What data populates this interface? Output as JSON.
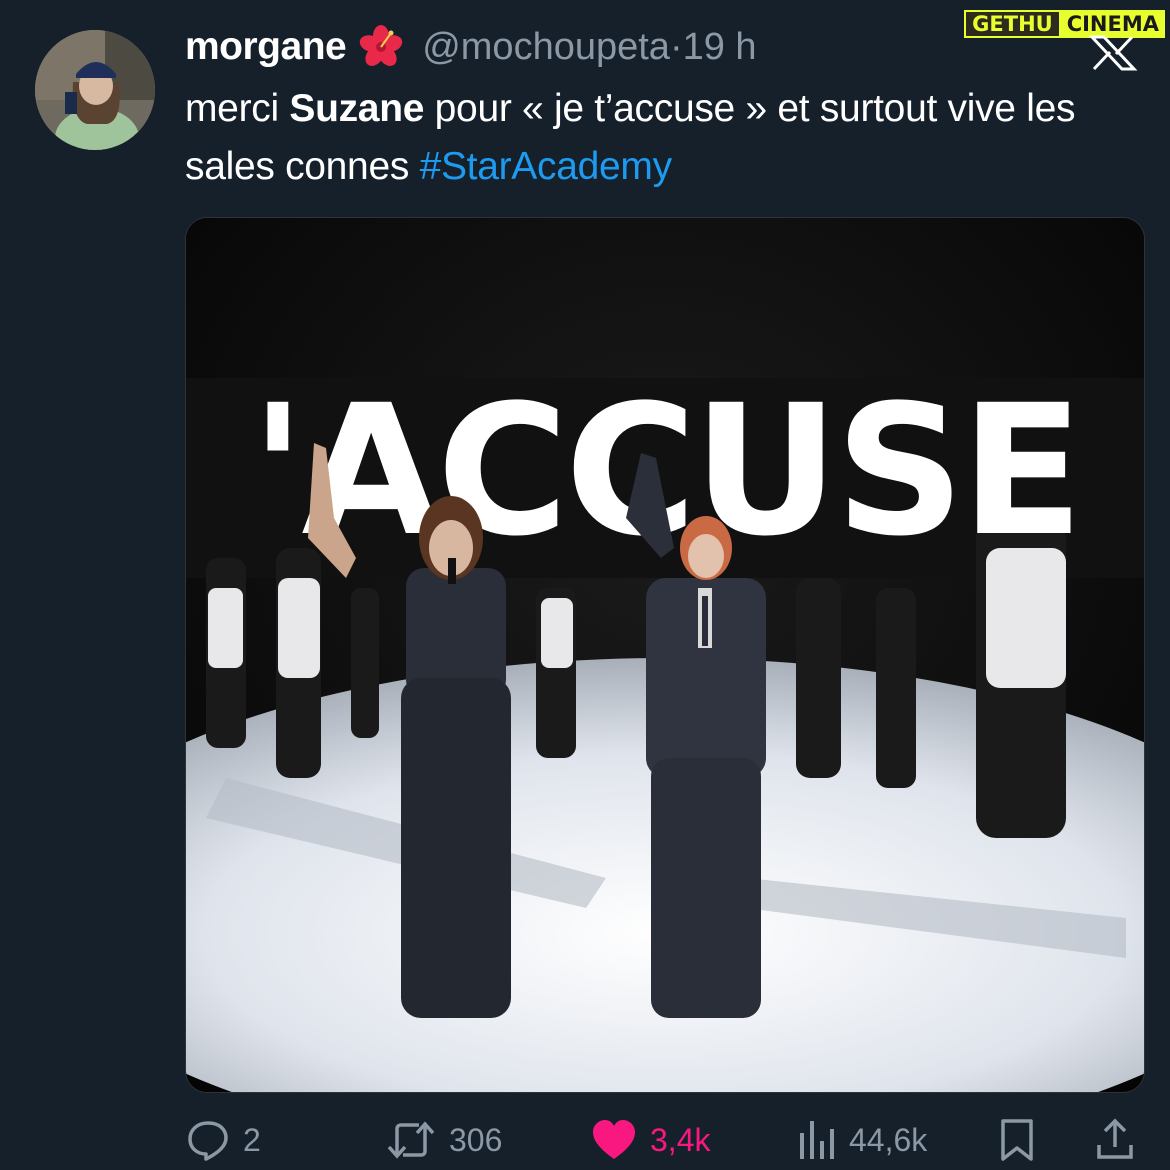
{
  "tweet": {
    "author_name": "morgane",
    "author_emoji_icon": "hibiscus-icon",
    "handle": "@mochoupeta",
    "separator": " · ",
    "time": "19 h",
    "text_part1": "merci ",
    "text_bold": "Suzane",
    "text_part2": " pour « je t’accuse » et surtout vive les sales connes ",
    "hashtag": "#StarAcademy",
    "media_icon": "photo-icon",
    "media_text": "'ACCUSE"
  },
  "actions": {
    "replies": "2",
    "retweets": "306",
    "likes": "3,4k",
    "views": "44,6k"
  },
  "watermark": {
    "part1": "GETHU",
    "part2": "CINEMA"
  },
  "colors": {
    "background": "#15202b",
    "secondary_text": "#8b98a5",
    "link": "#1d9bf0",
    "like": "#f91880"
  }
}
